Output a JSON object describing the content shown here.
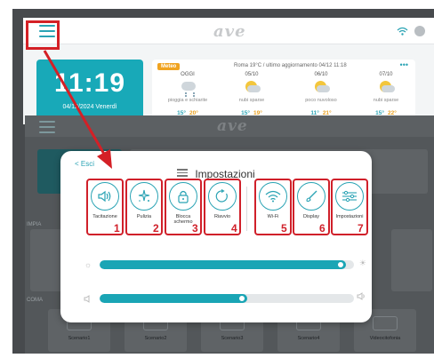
{
  "top_app": {
    "logo_text": "ave",
    "clock": {
      "time": "11:19",
      "date": "04/12/2024  Venerdì"
    },
    "weather": {
      "badge": "Meteo",
      "city": "Roma 19°C  /  ultimo aggiornamento 04/12 11:18",
      "more": "•••",
      "forecast": [
        {
          "day": "OGGI",
          "desc": "pioggia e schiarite",
          "min": "15°",
          "max": "20°",
          "icon": "rain-cloud-icon"
        },
        {
          "day": "05/10",
          "desc": "nubi sparse",
          "min": "15°",
          "max": "19°",
          "icon": "sun-cloud-icon"
        },
        {
          "day": "06/10",
          "desc": "poco nuvoloso",
          "min": "11°",
          "max": "21°",
          "icon": "sun-cloud-icon"
        },
        {
          "day": "07/10",
          "desc": "nubi sparse",
          "min": "15°",
          "max": "22°",
          "icon": "sun-cloud-icon"
        }
      ]
    }
  },
  "background_app": {
    "logo_text": "ave",
    "section_impianti": "IMPIA",
    "section_comandi": "COMA",
    "scenes": [
      "Scenario1",
      "Scenario2",
      "Scenario3",
      "Scenario4",
      "Videocitofonia"
    ]
  },
  "dialog": {
    "back_label": "< Esci",
    "title": "Impostazioni",
    "tiles": [
      {
        "label": "Tacitazione",
        "number": "1",
        "icon": "speaker-icon"
      },
      {
        "label": "Pulizia",
        "number": "2",
        "icon": "sparkle-icon"
      },
      {
        "label": "Blocca schermo",
        "number": "3",
        "icon": "lock-icon"
      },
      {
        "label": "Riavvio",
        "number": "4",
        "icon": "restart-icon"
      },
      {
        "label": "Wi-Fi",
        "number": "5",
        "icon": "wifi-icon"
      },
      {
        "label": "Display",
        "number": "6",
        "icon": "brush-icon"
      },
      {
        "label": "Impostazioni",
        "number": "7",
        "icon": "sliders-icon"
      }
    ],
    "brightness_level": 0.97,
    "volume_level": 0.58
  },
  "colors": {
    "accent": "#1aa5b5",
    "annotation": "#d0202a"
  }
}
